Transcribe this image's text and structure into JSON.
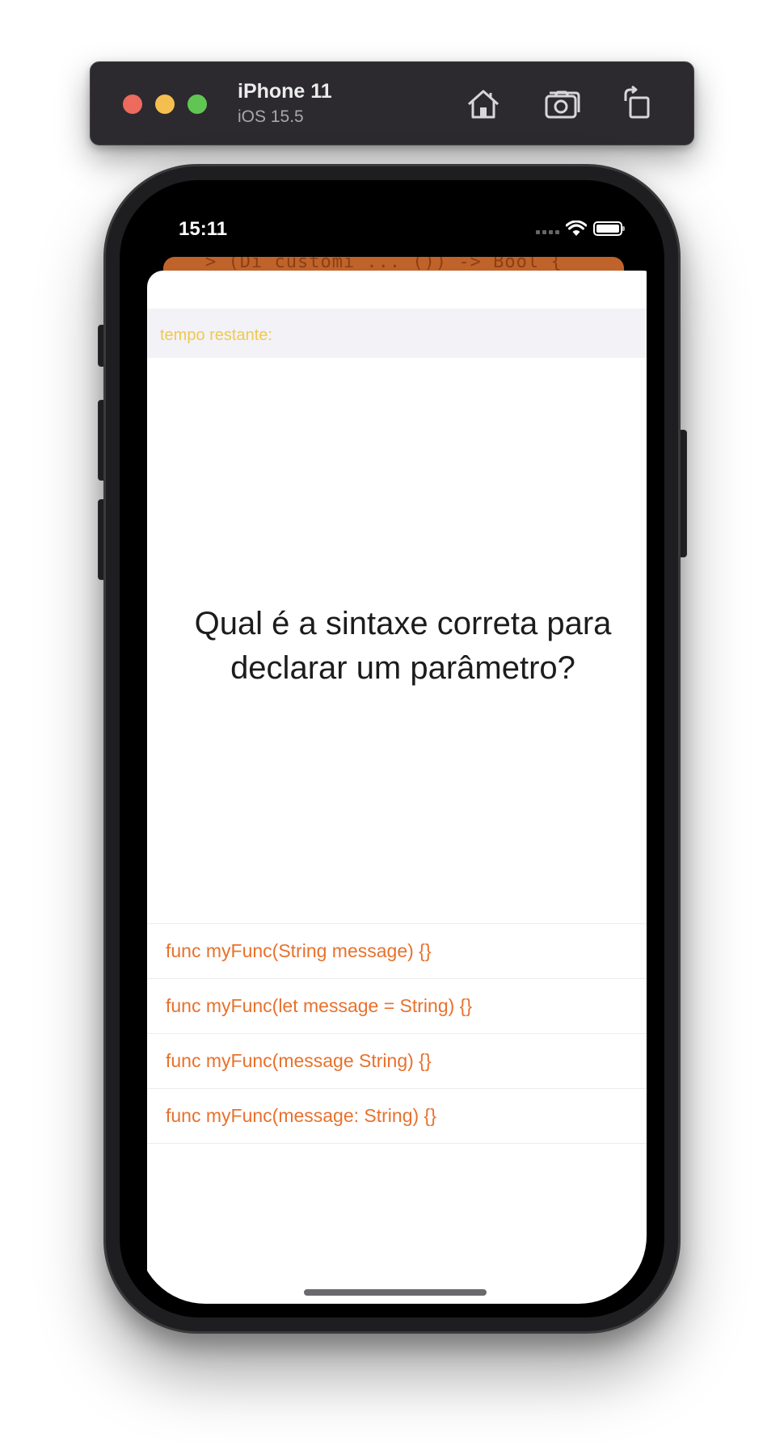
{
  "simulator": {
    "device_name": "iPhone 11",
    "os_version": "iOS 15.5",
    "icons": [
      "home-icon",
      "screenshot-icon",
      "rotate-icon"
    ]
  },
  "status_bar": {
    "time": "15:11",
    "icons": [
      "cellular-signal-icon",
      "wifi-icon",
      "battery-icon"
    ]
  },
  "background_card": {
    "code_snippet": "> (Di customi ... ()) -> Bool {"
  },
  "quiz": {
    "timer_label": "tempo restante:",
    "question": "Qual é a sintaxe correta para declarar um parâmetro?",
    "answers": [
      "func myFunc(String message) {}",
      "func myFunc(let message = String) {}",
      "func myFunc(message String) {}",
      "func myFunc(message: String) {}"
    ]
  },
  "colors": {
    "accent_orange": "#e8712c",
    "timer_yellow": "#f2c94c",
    "background_card": "#c0632a",
    "timer_bar_bg": "#f2f2f7"
  }
}
